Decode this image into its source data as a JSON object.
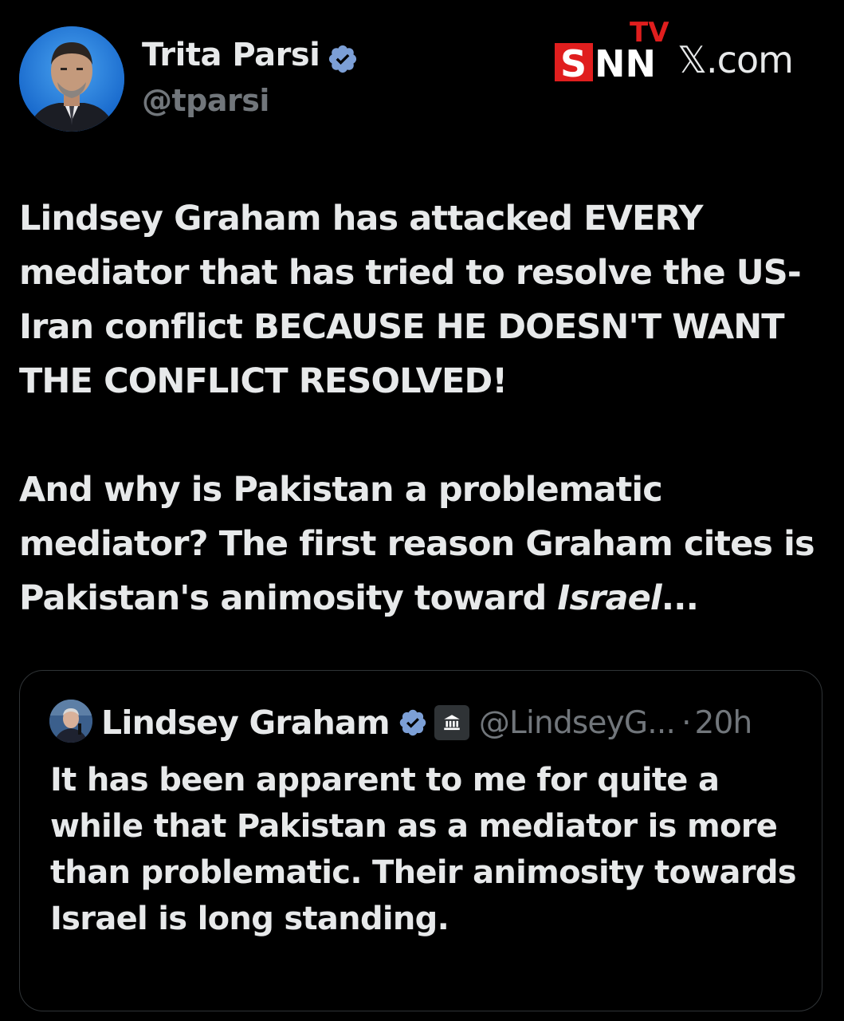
{
  "post": {
    "author": {
      "name": "Trita Parsi",
      "handle": "@tparsi",
      "verified_icon": "verified-badge-icon"
    },
    "watermark": {
      "brand": "SNN TV",
      "site": "𝕏.com"
    },
    "paragraph1": "Lindsey Graham has attacked EVERY mediator that has tried to resolve the US-Iran conflict BECAUSE HE DOESN'T WANT THE CONFLICT RESOLVED!",
    "paragraph2_lead": "And why is Pakistan a problematic mediator? The first reason Graham cites is Pakistan's animosity toward ",
    "paragraph2_italic": "Israel",
    "paragraph2_tail": "...",
    "quote": {
      "name": "Lindsey Graham",
      "handle": "@LindseyG...",
      "separator": "·",
      "time": "20h",
      "gov_icon": "government-building-icon",
      "text": "It has been apparent to me for quite a while that Pakistan as a mediator is more than problematic. Their animosity towards Israel is long standing."
    }
  },
  "colors": {
    "background": "#000000",
    "text": "#e7e9ea",
    "muted": "#71767b",
    "verified": "#7c9fd6",
    "snn_red": "#e01e1e"
  }
}
